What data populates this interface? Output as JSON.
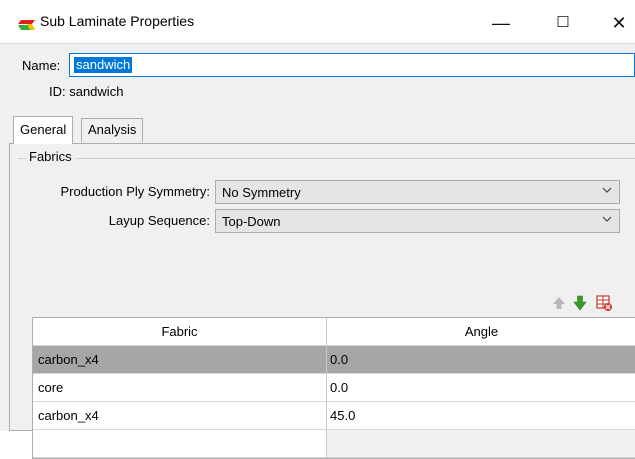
{
  "window": {
    "title": "Sub Laminate Properties",
    "controls": {
      "minimize": "—",
      "maximize": "☐",
      "close": "✕"
    }
  },
  "form": {
    "name_label": "Name:",
    "name_value": "sandwich",
    "id_text": "ID: sandwich"
  },
  "tabs": [
    {
      "label": "General",
      "active": true
    },
    {
      "label": "Analysis",
      "active": false
    }
  ],
  "fabrics": {
    "group_label": "Fabrics",
    "symmetry_label": "Production Ply Symmetry:",
    "symmetry_value": "No Symmetry",
    "sequence_label": "Layup Sequence:",
    "sequence_value": "Top-Down",
    "toolbar_icons": [
      "arrow-up-icon",
      "arrow-down-icon",
      "delete-icon"
    ],
    "table": {
      "columns": [
        "Fabric",
        "Angle"
      ],
      "rows": [
        {
          "fabric": "carbon_x4",
          "angle": "0.0",
          "selected": true
        },
        {
          "fabric": "core",
          "angle": "0.0",
          "selected": false
        },
        {
          "fabric": "carbon_x4",
          "angle": "45.0",
          "selected": false
        }
      ]
    }
  },
  "colors": {
    "accent": "#0078d7",
    "selected_row": "#a6a6a6",
    "dialog_bg": "#f0f0f0"
  }
}
